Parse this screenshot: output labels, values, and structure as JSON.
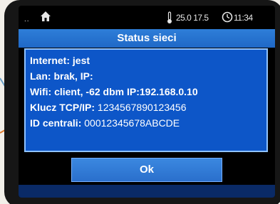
{
  "statusbar": {
    "dots": "..",
    "temperature": "25.0 17.5",
    "time": "11:34"
  },
  "dialog": {
    "title": "Status sieci",
    "rows": [
      {
        "label": "Internet: jest",
        "value": ""
      },
      {
        "label": "Lan: brak, IP:",
        "value": ""
      },
      {
        "label": "Wifi: client, -62 dbm IP:192.168.0.10",
        "value": ""
      },
      {
        "label": "Klucz TCP/IP:",
        "value": " 1234567890123456"
      },
      {
        "label": "ID centrali:",
        "value": " 00012345678ABCDE"
      }
    ],
    "ok_label": "Ok"
  },
  "icons": {
    "home": "home-icon",
    "thermometer": "thermometer-icon",
    "clock": "clock-icon"
  },
  "colors": {
    "title_bar": "#1f68c7",
    "panel": "#0d56c8",
    "panel_border": "#8fc3ff",
    "callout_blue": "#6aa0c8",
    "callout_orange": "#e07a2e"
  }
}
